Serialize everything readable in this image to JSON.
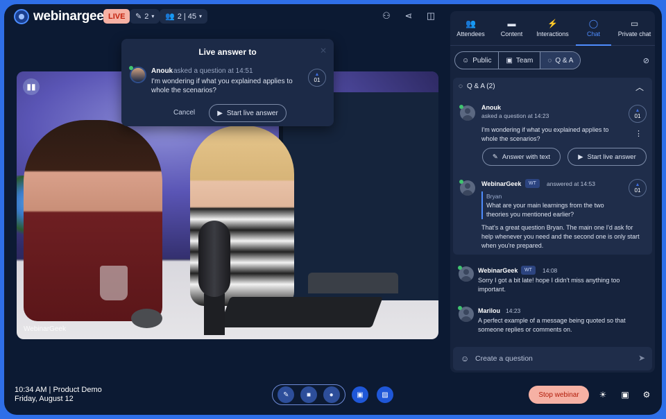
{
  "header": {
    "logo_text": "webinargeek",
    "live_label": "LIVE",
    "hosts_count": "2",
    "attendees_count": "2 | 45",
    "icons": [
      "robot-icon",
      "share-icon",
      "layout-panel-icon"
    ]
  },
  "video": {
    "watermark": "WebinarGeek"
  },
  "popup": {
    "title": "Live answer to",
    "name": "Anouk",
    "meta": "asked a question at 14:51",
    "text": "I'm wondering if what you explained applies to whole the scenarios?",
    "votes": "01",
    "cancel_label": "Cancel",
    "start_label": "Start live answer"
  },
  "footer": {
    "time_title": "10:34 AM | Product Demo",
    "date": "Friday, August 12",
    "stop_label": "Stop webinar"
  },
  "panel": {
    "tabs": [
      {
        "label": "Attendees",
        "icon": "people-icon"
      },
      {
        "label": "Content",
        "icon": "folder-icon"
      },
      {
        "label": "Interactions",
        "icon": "bolt-icon"
      },
      {
        "label": "Chat",
        "icon": "chat-icon"
      },
      {
        "label": "Private chat",
        "icon": "private-chat-icon"
      }
    ],
    "subtabs": [
      {
        "label": "Public",
        "icon": "public-icon"
      },
      {
        "label": "Team",
        "icon": "team-icon"
      },
      {
        "label": "Q & A",
        "icon": "qa-icon"
      }
    ],
    "qa": {
      "header": "Q & A (2)",
      "question": {
        "name": "Anouk",
        "meta": "asked a question at 14:23",
        "text": "I'm wondering if what you explained applies to whole the scenarios?",
        "votes": "01",
        "answer_text_label": "Answer with text",
        "start_live_label": "Start live answer"
      },
      "answer": {
        "name": "WebinarGeek",
        "badge": "WT",
        "meta": "answered at 14:53",
        "votes": "01",
        "quote_name": "Bryan",
        "quote_text": "What are your main learnings from the two theories you mentioned earlier?",
        "text": "That's a great question Bryan. The main one I'd ask for help whenever you need and the second one is only start when you're prepared."
      }
    },
    "messages": [
      {
        "name": "WebinarGeek",
        "badge": "WT",
        "time": "14:08",
        "text": "Sorry I got a bit late! hope I didn't miss anything too important."
      },
      {
        "name": "Marilou",
        "badge": "",
        "time": "14:23",
        "text": "A perfect example of a message being quoted so that someone replies or comments on."
      }
    ],
    "input_placeholder": "Create a question"
  },
  "colors": {
    "background": "#0c1a33",
    "accent": "#4f8dff",
    "live": "#f6b1a4",
    "online": "#3fc36f"
  }
}
